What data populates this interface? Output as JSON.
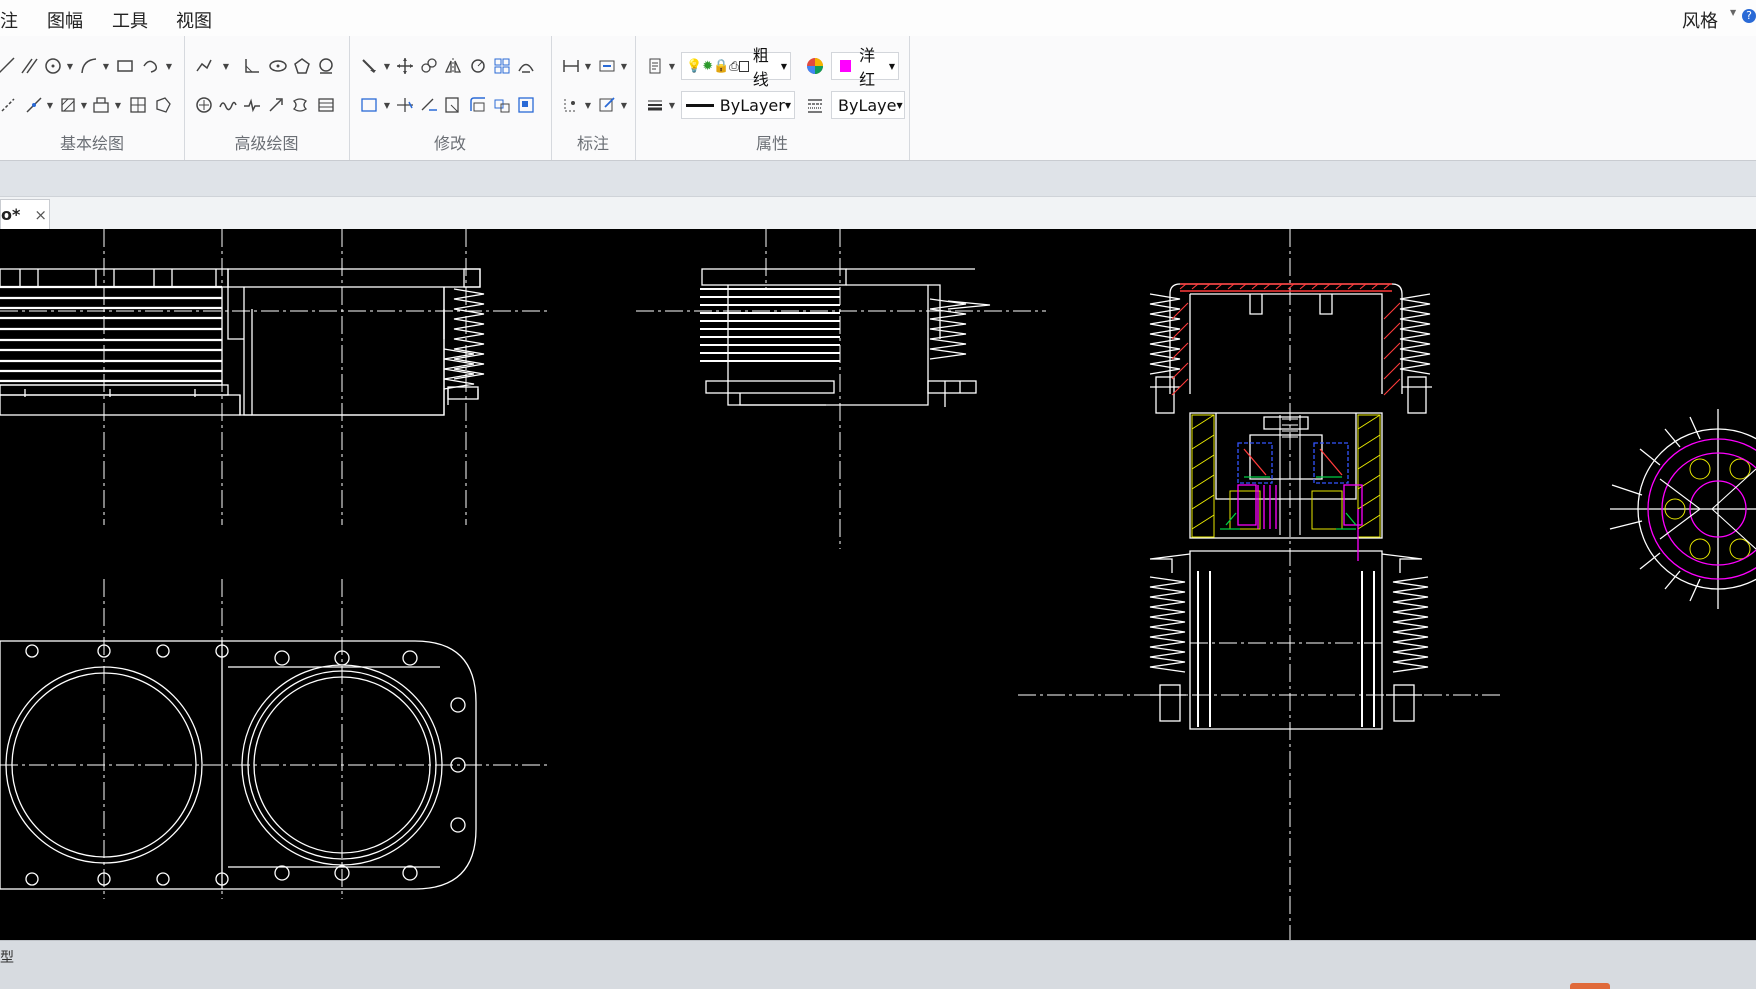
{
  "menubar": {
    "items": [
      "注",
      "图幅",
      "工具",
      "视图"
    ],
    "style_label": "风格"
  },
  "ribbon": {
    "groups": [
      "基本绘图",
      "高级绘图",
      "修改",
      "标注",
      "属性"
    ],
    "properties": {
      "layer_text": "粗线",
      "linetype_value": "ByLayer",
      "color_value": "ByLaye",
      "color_swatch_text": "洋红"
    }
  },
  "document": {
    "tab_name": "o*",
    "close_glyph": "×"
  },
  "statusbar": {
    "left_text": "型"
  },
  "colors": {
    "background": "#000000",
    "line": "#ffffff",
    "hatch_red": "#ff3b3b",
    "hatch_yellow": "#e8e800",
    "accent_magenta": "#ff00ff",
    "accent_blue": "#3355ff",
    "accent_green": "#00cc44"
  }
}
